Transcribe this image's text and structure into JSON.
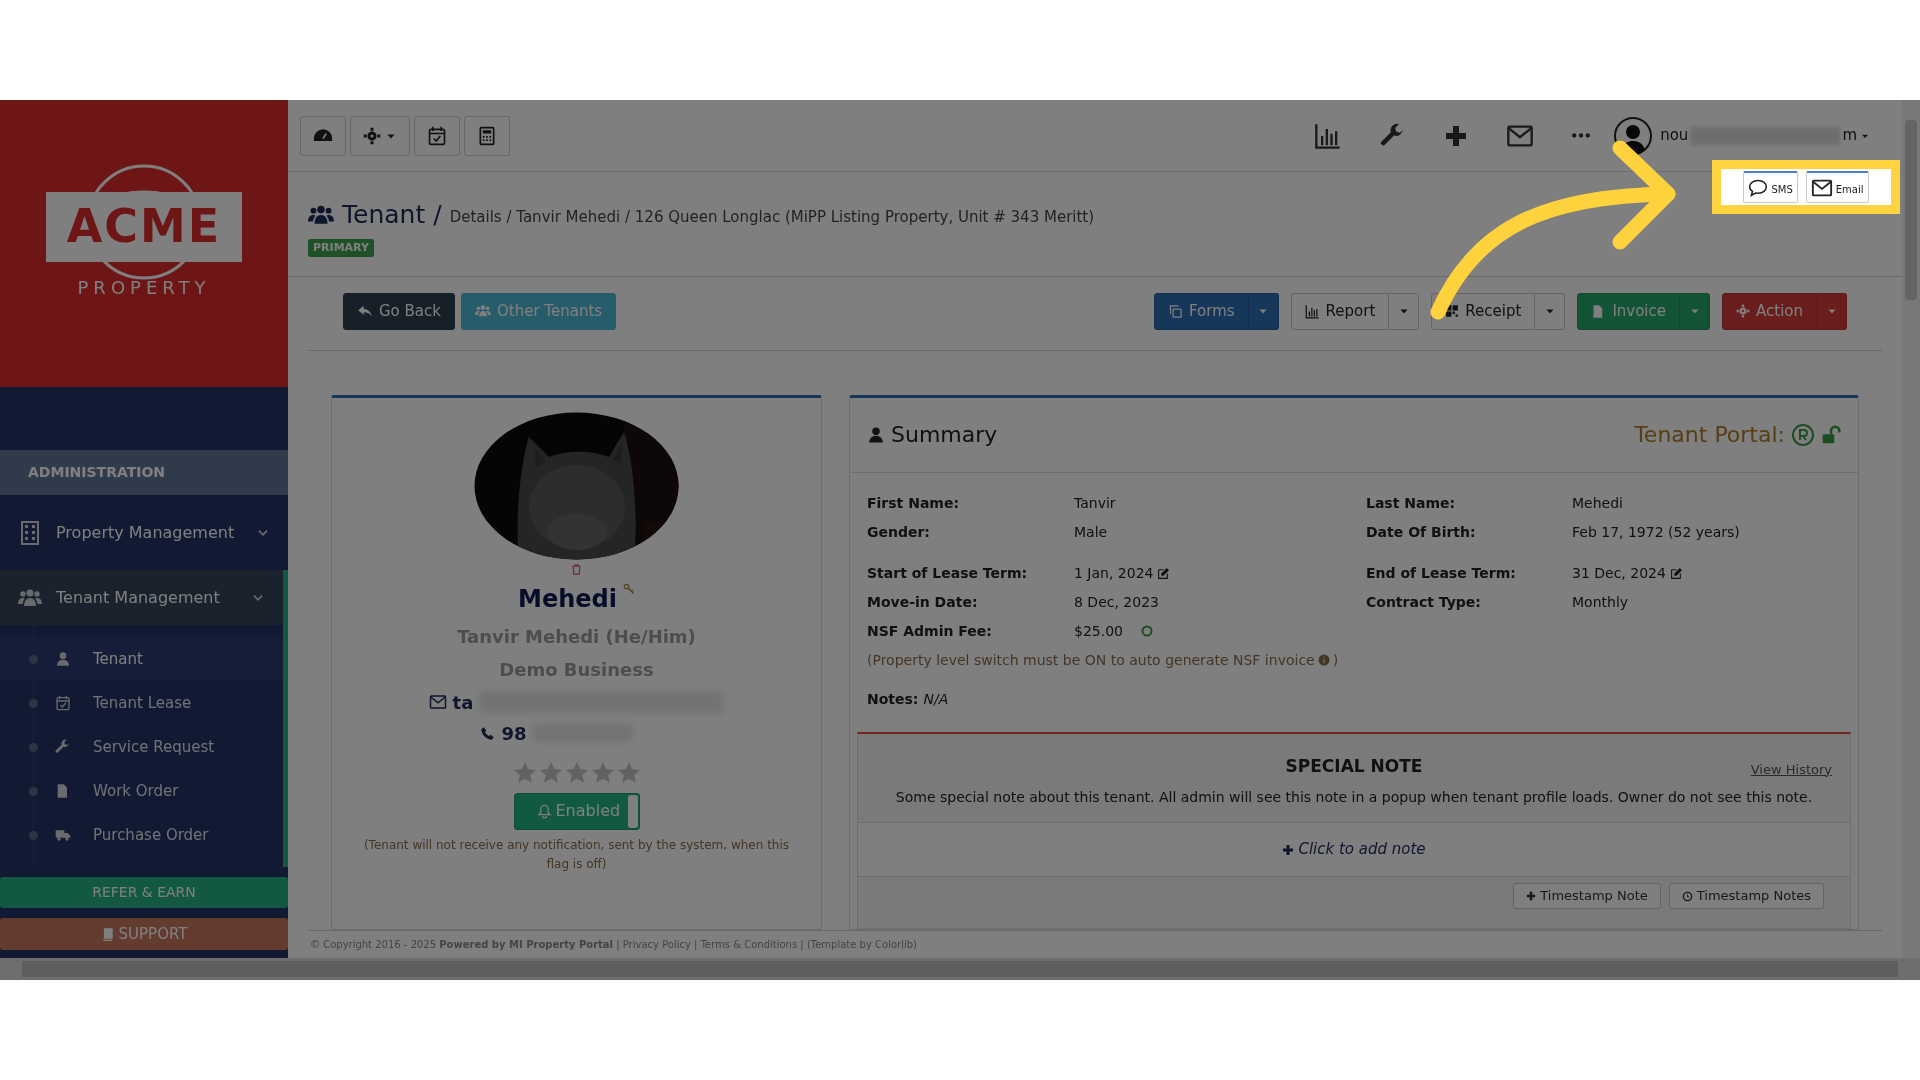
{
  "sidebar": {
    "logo": {
      "name": "ACME",
      "tagline": "PROPERTY"
    },
    "section": "ADMINISTRATION",
    "items": [
      {
        "label": "Property Management",
        "kind": "building",
        "expanded": false
      },
      {
        "label": "Tenant Management",
        "kind": "users",
        "expanded": true,
        "children": [
          {
            "label": "Tenant",
            "kind": "user",
            "selected": true
          },
          {
            "label": "Tenant Lease",
            "kind": "calendar",
            "selected": false
          },
          {
            "label": "Service Request",
            "kind": "wrench",
            "selected": false
          },
          {
            "label": "Work Order",
            "kind": "files",
            "selected": false
          },
          {
            "label": "Purchase Order",
            "kind": "truck",
            "selected": false
          }
        ]
      }
    ],
    "refer": "REFER & EARN",
    "support": "SUPPORT"
  },
  "top_nav": {
    "user_start": "nou",
    "user_end": "m"
  },
  "quick_send": {
    "buttons": [
      {
        "label": "SMS",
        "kind": "sms"
      },
      {
        "label": "Email",
        "kind": "email"
      }
    ]
  },
  "header": {
    "title": "Tenant",
    "separator": "/",
    "path": "Details / Tanvir Mehedi / 126 Queen Longlac (MiPP Listing Property, Unit # 343 Meritt)",
    "badge": "PRIMARY"
  },
  "actions_left": [
    {
      "label": "Go Back",
      "kind": "back"
    },
    {
      "label": "Other Tenants",
      "kind": "tenants"
    }
  ],
  "actions_right": [
    {
      "label": "Forms",
      "kind": "forms"
    },
    {
      "label": "Report",
      "kind": "report"
    },
    {
      "label": "Receipt",
      "kind": "receipt"
    },
    {
      "label": "Invoice",
      "kind": "invoice"
    },
    {
      "label": "Action",
      "kind": "action"
    }
  ],
  "profile": {
    "name": "Mehedi",
    "full_name": "Tanvir Mehedi (He/Him)",
    "business": "Demo Business",
    "email_start": "ta",
    "phone_start": "98",
    "stars": 0,
    "notification": {
      "label": "Enabled",
      "on": true
    },
    "note": "(Tenant will not receive any notification, sent by the system, when this flag is off)"
  },
  "summary": {
    "title": "Summary",
    "portal_label": "Tenant Portal:",
    "groups": [
      [
        [
          {
            "label": "First Name:",
            "value": "Tanvir",
            "kind": "text"
          },
          {
            "label": "Last Name:",
            "value": "Mehedi",
            "kind": "text"
          }
        ],
        [
          {
            "label": "Gender:",
            "value": "Male",
            "kind": "text"
          },
          {
            "label": "Date Of Birth:",
            "value": "Feb 17, 1972 (52 years)",
            "kind": "text"
          }
        ]
      ],
      [
        [
          {
            "label": "Start of Lease Term:",
            "value": "1 Jan, 2024",
            "kind": "editable"
          },
          {
            "label": "End of Lease Term:",
            "value": "31 Dec, 2024",
            "kind": "editable"
          }
        ],
        [
          {
            "label": "Move-in Date:",
            "value": "8 Dec, 2023",
            "kind": "text"
          },
          {
            "label": "Contract Type:",
            "value": "Monthly",
            "kind": "text"
          }
        ],
        [
          {
            "label": "NSF Admin Fee:",
            "value": "$25.00",
            "kind": "fee"
          }
        ]
      ]
    ],
    "nsf_note": "(Property level switch must be ON to auto generate NSF invoice",
    "nsf_note_end": ")",
    "notes_label": "Notes:",
    "notes_value": "N/A"
  },
  "special_note": {
    "title": "SPECIAL NOTE",
    "link": "View History",
    "text": "Some special note about this tenant. All admin will see this note in a popup when tenant profile loads. Owner do not see this note.",
    "add": "Click to add note",
    "buttons": [
      {
        "label": "Timestamp Note",
        "kind": "add"
      },
      {
        "label": "Timestamp Notes",
        "kind": "history"
      }
    ]
  },
  "footer": "© Copyright 2016 - 2025 **Powered by MI Property Portal** | Privacy Policy | Terms & Conditions | (Template by Colorlib)"
}
